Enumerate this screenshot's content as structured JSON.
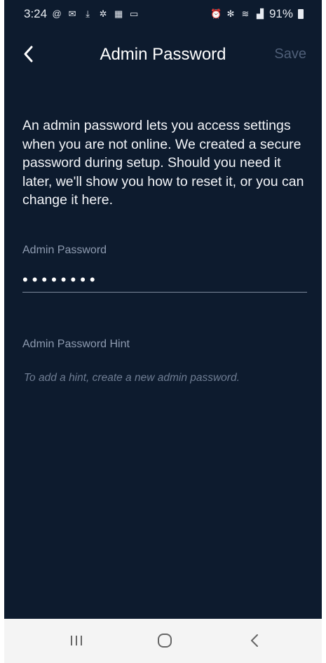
{
  "status_bar": {
    "time": "3:24",
    "left_icons": [
      "at-sign-icon",
      "mail-icon",
      "download-icon",
      "pinwheel-icon",
      "calendar-icon",
      "monitor-icon"
    ],
    "right_icons": [
      "alarm-icon",
      "bluetooth-icon",
      "wifi-icon",
      "4g-signal-icon"
    ],
    "battery": "91%"
  },
  "header": {
    "title": "Admin Password",
    "save_label": "Save"
  },
  "description": "An admin password lets you access settings when you are not online. We created a secure password during setup. Should you need it later, we'll show you how to reset it, or you can change it here.",
  "password_field": {
    "label": "Admin Password",
    "value": "••••••••"
  },
  "hint_field": {
    "label": "Admin Password Hint",
    "text": "To add a hint, create a new admin password."
  },
  "colors": {
    "background": "#0d1b2e",
    "save_disabled": "#4f5f78",
    "label": "#8e9bb0",
    "nav_bar": "#f4f4f4"
  }
}
